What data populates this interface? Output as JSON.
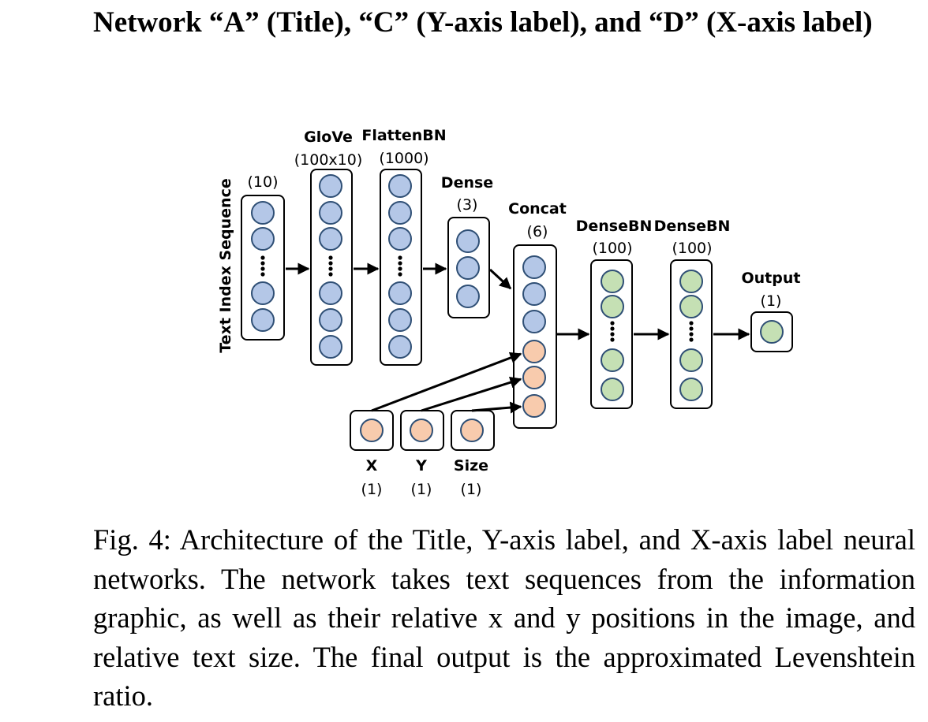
{
  "heading": "Network “A” (Title), “C” (Y-axis label), and “D” (X-axis label)",
  "caption": "Fig. 4: Architecture of the Title, Y-axis label, and X-axis label neural networks. The network takes text sequences from the information graphic, as well as their relative x and y positions in the image, and relative text size. The final output is the approximated Levenshtein ratio.",
  "diagram": {
    "side_label": "Text Index Sequence",
    "colors": {
      "blue": "#b4c7e7",
      "orange": "#f8cbad",
      "green": "#c5e0b4",
      "stroke": "#2f4f75",
      "box": "#000000"
    },
    "layers": {
      "input": {
        "name": "",
        "size": "(10)"
      },
      "glove": {
        "name": "GloVe",
        "size": "(100x10)"
      },
      "flatten": {
        "name": "FlattenBN",
        "size": "(1000)"
      },
      "dense": {
        "name": "Dense",
        "size": "(3)"
      },
      "concat": {
        "name": "Concat",
        "size": "(6)"
      },
      "dense_bn_1": {
        "name": "DenseBN",
        "size": "(100)"
      },
      "dense_bn_2": {
        "name": "DenseBN",
        "size": "(100)"
      },
      "output": {
        "name": "Output",
        "size": "(1)"
      },
      "x": {
        "name": "X",
        "size": "(1)"
      },
      "y": {
        "name": "Y",
        "size": "(1)"
      },
      "text_size": {
        "name": "Size",
        "size": "(1)"
      }
    }
  }
}
